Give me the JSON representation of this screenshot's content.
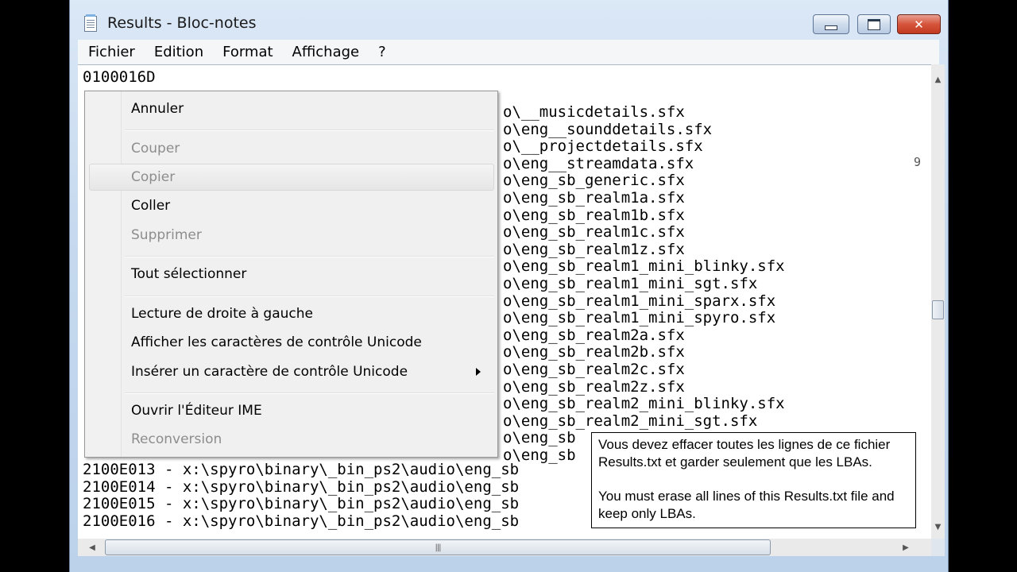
{
  "window": {
    "title": "Results - Bloc-notes"
  },
  "menubar": [
    "Fichier",
    "Edition",
    "Format",
    "Affichage",
    "?"
  ],
  "editor": {
    "first_line": "0100016D",
    "lines_right": [
      "o\\__musicdetails.sfx",
      "o\\eng__sounddetails.sfx",
      "o\\__projectdetails.sfx",
      "o\\eng__streamdata.sfx",
      "o\\eng_sb_generic.sfx",
      "o\\eng_sb_realm1a.sfx",
      "o\\eng_sb_realm1b.sfx",
      "o\\eng_sb_realm1c.sfx",
      "o\\eng_sb_realm1z.sfx",
      "o\\eng_sb_realm1_mini_blinky.sfx",
      "o\\eng_sb_realm1_mini_sgt.sfx",
      "o\\eng_sb_realm1_mini_sparx.sfx",
      "o\\eng_sb_realm1_mini_spyro.sfx",
      "o\\eng_sb_realm2a.sfx",
      "o\\eng_sb_realm2b.sfx",
      "o\\eng_sb_realm2c.sfx",
      "o\\eng_sb_realm2z.sfx",
      "o\\eng_sb_realm2_mini_blinky.sfx",
      "o\\eng_sb_realm2_mini_sgt.sfx",
      "o\\eng_sb",
      "o\\eng_sb"
    ],
    "lines_full": [
      "2100E013 - x:\\spyro\\binary\\_bin_ps2\\audio\\eng_sb",
      "2100E014 - x:\\spyro\\binary\\_bin_ps2\\audio\\eng_sb",
      "2100E015 - x:\\spyro\\binary\\_bin_ps2\\audio\\eng_sb",
      "2100E016 - x:\\spyro\\binary\\_bin_ps2\\audio\\eng_sb"
    ]
  },
  "context_menu": {
    "items": [
      {
        "label": "Annuler",
        "enabled": true
      },
      {
        "label": "Couper",
        "enabled": false
      },
      {
        "label": "Copier",
        "enabled": false
      },
      {
        "label": "Coller",
        "enabled": true
      },
      {
        "label": "Supprimer",
        "enabled": false
      },
      {
        "label": "Tout sélectionner",
        "enabled": true
      },
      {
        "label": "Lecture de droite à gauche",
        "enabled": true
      },
      {
        "label": "Afficher les caractères de contrôle Unicode",
        "enabled": true
      },
      {
        "label": "Insérer un caractère de contrôle Unicode",
        "enabled": true
      },
      {
        "label": "Ouvrir l'Éditeur IME",
        "enabled": true
      },
      {
        "label": "Reconversion",
        "enabled": false
      }
    ]
  },
  "tooltip": {
    "fr": "Vous devez effacer toutes les lignes de ce fichier Results.txt et garder seulement que les LBAs.",
    "en": "You must erase all lines of this Results.txt file and keep only LBAs."
  },
  "icons": {
    "app": "notepad-icon",
    "minimize": "minimize-icon",
    "maximize": "maximize-icon",
    "close": "close-icon",
    "submenu": "chevron-right-icon",
    "scroll_up": "arrow-up-icon",
    "scroll_down": "arrow-down-icon",
    "scroll_left": "arrow-left-icon",
    "scroll_right": "arrow-right-icon"
  }
}
